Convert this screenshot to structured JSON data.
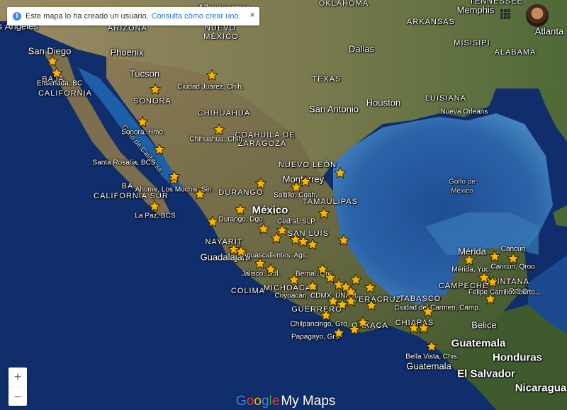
{
  "banner": {
    "text": "Este mapa lo ha creado un usuario.",
    "link": "Consulta cómo crear uno.",
    "close": "×",
    "info": "i"
  },
  "logo": {
    "g1": "G",
    "g2": "o",
    "g3": "o",
    "g4": "g",
    "g5": "l",
    "g6": "e",
    "suffix": "My Maps"
  },
  "zoom": {
    "in": "+",
    "out": "−"
  },
  "colors": {
    "pin": "#f7b500",
    "land": "#6b6a45",
    "ocean": "#0f2e6b",
    "gulf": "#1e4d94",
    "shelf": "#3a79b8"
  },
  "labels": {
    "countries": [
      "México",
      "Guatemala",
      "Honduras",
      "El Salvador",
      "Nicaragua",
      "Belice",
      "TENNESSEE"
    ],
    "states_mx": [
      "BAJA",
      "CALIFORNIA",
      "SONORA",
      "CHIHUAHUA",
      "COAHUILA DE",
      "ZARAGOZA",
      "NUEVO LEÓN",
      "TAMAULIPAS",
      "DURANGO",
      "SAN LUIS",
      "NAYARIT",
      "COLIMA",
      "MICHOACÁN",
      "GUERRERO",
      "VERACRUZ",
      "TABASCO",
      "CAMPECHE",
      "CHIAPAS",
      "QUINTANA",
      "ROO",
      "BA",
      "CALIFORNIA SUR",
      "OAXACA"
    ],
    "states_us": [
      "ARIZONA",
      "NUEVO",
      "MÉXICO",
      "TEXAS",
      "OKLAHOMA",
      "ARKANSAS",
      "MISISIPI",
      "ALABAMA",
      "LUISIANA"
    ],
    "cities": [
      "Los Ángeles",
      "San Diego",
      "Phoenix",
      "Tucson",
      "Albuquerque",
      "Dallas",
      "Houston",
      "San Antonio",
      "Memphis",
      "Atlanta",
      "Nueva Orleans",
      "Monterrey",
      "Guadalajara",
      "Mérida",
      "Cancún",
      "Guatemala"
    ],
    "seas": [
      "Golfo de",
      "México",
      "Golfo de California"
    ],
    "places": [
      "Ensenada, BC",
      "Ciudad Juárez, Chih.",
      "Chihuahua, Chih.",
      "Sonora, Hmo.",
      "Santa Rosalía, BCS",
      "Ahome, Los Mochis, Sin.",
      "La Paz, BCS",
      "Saltillo, Coah.",
      "Durango, Dgo.",
      "Cedral, SLP",
      "Aguascalientes, Ags.",
      "Jalisco, Gdl.",
      "Bernal, Qro.",
      "Coyoacán, CDMX, UNAM",
      "Chilpancingo, Gro.",
      "Papagayo, Gro.",
      "Ciudad del Carmen, Camp.",
      "Mérida, Yuc.",
      "Cancún, Qroo.",
      "Felipe Carrillo Puerto...",
      "Bella Vista, Chis."
    ]
  },
  "pins": [
    {
      "name": "Ensenada, BC"
    },
    {
      "name": "Ciudad Juárez, Chih."
    },
    {
      "name": "Chihuahua, Chih."
    },
    {
      "name": "Sonora, Hmo."
    },
    {
      "name": "Santa Rosalía, BCS"
    },
    {
      "name": "Ahome, Los Mochis, Sin."
    },
    {
      "name": "La Paz, BCS"
    },
    {
      "name": "Saltillo, Coah."
    },
    {
      "name": "Durango, Dgo."
    },
    {
      "name": "Cedral, SLP"
    },
    {
      "name": "Aguascalientes, Ags."
    },
    {
      "name": "Jalisco, Gdl."
    },
    {
      "name": "Bernal, Qro."
    },
    {
      "name": "Coyoacán, CDMX, UNAM"
    },
    {
      "name": "Chilpancingo, Gro."
    },
    {
      "name": "Papagayo, Gro."
    },
    {
      "name": "Ciudad del Carmen, Camp."
    },
    {
      "name": "Mérida, Yuc."
    },
    {
      "name": "Cancún, Qroo."
    },
    {
      "name": "Felipe Carrillo Puerto..."
    },
    {
      "name": "Bella Vista, Chis."
    }
  ]
}
